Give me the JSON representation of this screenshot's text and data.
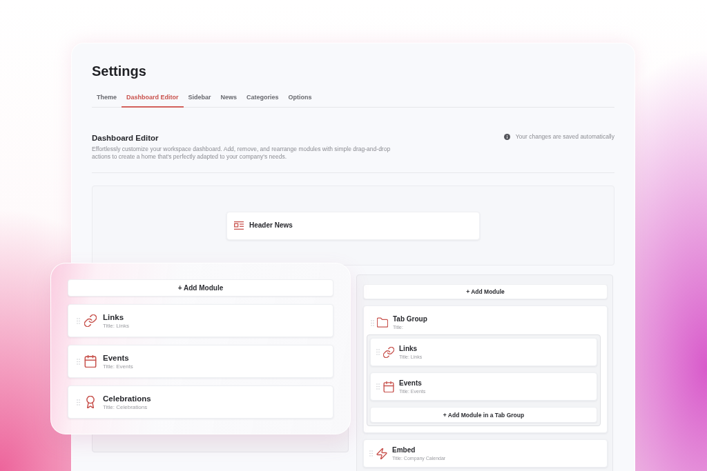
{
  "window": {
    "title": "Settings"
  },
  "tabs": [
    {
      "label": "Theme",
      "selected": false
    },
    {
      "label": "Dashboard Editor",
      "selected": true
    },
    {
      "label": "Sidebar",
      "selected": false
    },
    {
      "label": "News",
      "selected": false
    },
    {
      "label": "Categories",
      "selected": false
    },
    {
      "label": "Options",
      "selected": false
    }
  ],
  "section": {
    "title": "Dashboard Editor",
    "description": "Effortlessly customize your workspace dashboard. Add, remove, and rearrange modules with simple drag-and-drop actions to create a home that's perfectly adapted to your company's needs.",
    "notice": "Your changes are saved automatically"
  },
  "header_area": {
    "modules": [
      {
        "kind": "header_news",
        "title": "Header News"
      }
    ]
  },
  "columns": [
    {
      "add_label": "+ Add Module",
      "modules": [
        {
          "kind": "links",
          "title": "Links",
          "subtitle": "Title: Links"
        },
        {
          "kind": "events",
          "title": "Events",
          "subtitle": "Title: Events"
        },
        {
          "kind": "celebrations",
          "title": "Celebrations",
          "subtitle": "Title: Celebrations"
        }
      ]
    },
    {
      "add_label": "+ Add Module",
      "modules": [
        {
          "kind": "tab_group",
          "title": "Tab Group",
          "subtitle": "Title:",
          "children": [
            {
              "kind": "links",
              "title": "Links",
              "subtitle": "Title: Links"
            },
            {
              "kind": "events",
              "title": "Events",
              "subtitle": "Title: Events"
            }
          ],
          "add_label": "+ Add Module in a Tab Group"
        },
        {
          "kind": "embed",
          "title": "Embed",
          "subtitle": "Title: Company Calendar"
        }
      ]
    }
  ]
}
